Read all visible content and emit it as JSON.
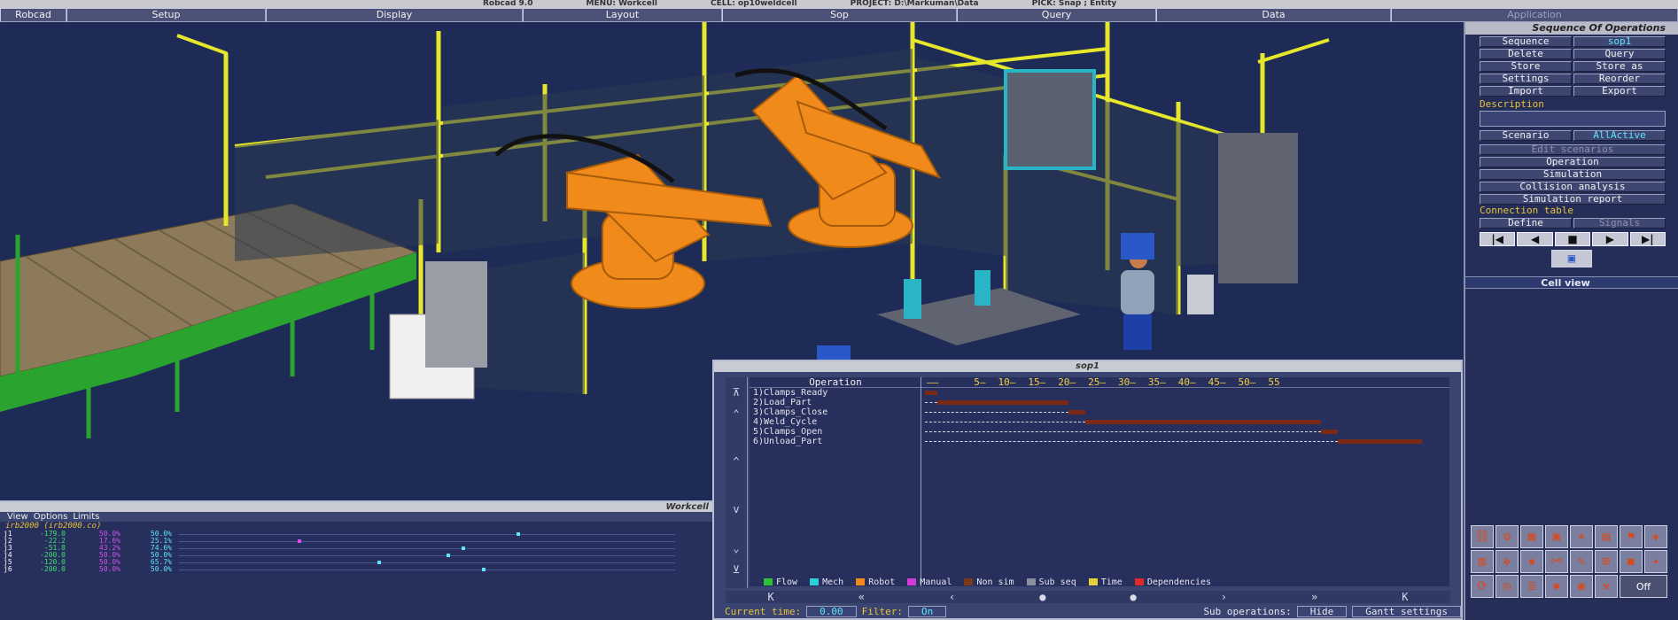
{
  "window": {
    "title_segments": [
      "Robcad 9.0",
      "MENU: Workcell",
      "CELL: op10weldcell",
      "PROJECT: D:\\Markuman\\Data",
      "PICK: Snap ; Entity"
    ]
  },
  "menubar": [
    "Robcad",
    "Setup",
    "Display",
    "Layout",
    "Sop",
    "Query",
    "Data",
    "Application"
  ],
  "sop_panel": {
    "title": "Sequence Of Operations",
    "sequence_label": "Sequence",
    "sequence_value": "sop1",
    "buttons": [
      "Delete",
      "Query",
      "Store",
      "Store as",
      "Settings",
      "Reorder",
      "Import",
      "Export"
    ],
    "description_label": "Description",
    "scenario_label": "Scenario",
    "scenario_value": "AllActive",
    "edit_scenarios": "Edit scenarios",
    "operation": "Operation",
    "simulation": "Simulation",
    "collision_analysis": "Collision analysis",
    "simulation_report": "Simulation report",
    "connection_table_label": "Connection table",
    "define": "Define",
    "signals": "Signals",
    "cell_view_title": "Cell view",
    "off_label": "Off"
  },
  "gantt": {
    "title": "sop1",
    "operation_header": "Operation",
    "scale_labels": [
      "5",
      "10",
      "15",
      "20",
      "25",
      "30",
      "35",
      "40",
      "45",
      "50",
      "55"
    ],
    "operations": [
      {
        "label": "1)Clamps_Ready",
        "start": 0,
        "end": 1.5
      },
      {
        "label": "2)Load_Part",
        "start": 1.5,
        "end": 17
      },
      {
        "label": "3)Clamps_Close",
        "start": 17,
        "end": 19
      },
      {
        "label": "4)Weld_Cycle",
        "start": 19,
        "end": 47
      },
      {
        "label": "5)Clamps_Open",
        "start": 47,
        "end": 49
      },
      {
        "label": "6)Unload_Part",
        "start": 49,
        "end": 59
      }
    ],
    "time_max": 62,
    "legend": [
      {
        "label": "Flow",
        "color": "#2fbf3a"
      },
      {
        "label": "Mech",
        "color": "#2ccfd6"
      },
      {
        "label": "Robot",
        "color": "#f08a1a"
      },
      {
        "label": "Manual",
        "color": "#d43ad8"
      },
      {
        "label": "Non sim",
        "color": "#7a3a1a"
      },
      {
        "label": "Sub seq",
        "color": "#8a8f9c"
      },
      {
        "label": "Time",
        "color": "#e6d23a"
      },
      {
        "label": "Dependencies",
        "color": "#e02a2a"
      }
    ],
    "bar_color": "#7a2a14",
    "nav": [
      "K",
      "«",
      "‹",
      "●",
      "●",
      "›",
      "»",
      "K"
    ],
    "status": {
      "current_time_label": "Current time:",
      "current_time_value": "0.00",
      "filter_label": "Filter:",
      "filter_value": "On",
      "sub_operations_label": "Sub operations:",
      "sub_operations_value": "Hide",
      "gantt_settings": "Gantt settings"
    }
  },
  "workcell": {
    "title": "Workcell",
    "menu": [
      "View",
      "Options",
      "Limits"
    ],
    "robot": "irb2000 (irb2000.co)",
    "joints": [
      {
        "n": "j1",
        "v": "-179.0",
        "p": "50.0%",
        "q": "50.0%",
        "marker": 0.68
      },
      {
        "n": "j2",
        "v": "-22.2",
        "p": "17.6%",
        "q": "25.1%",
        "marker": 0.24
      },
      {
        "n": "j3",
        "v": "-51.8",
        "p": "43.2%",
        "q": "74.6%",
        "marker": 0.57
      },
      {
        "n": "j4",
        "v": "-200.0",
        "p": "50.0%",
        "q": "50.0%",
        "marker": 0.54
      },
      {
        "n": "j5",
        "v": "-120.0",
        "p": "50.0%",
        "q": "65.7%",
        "marker": 0.4
      },
      {
        "n": "j6",
        "v": "-200.0",
        "p": "50.0%",
        "q": "50.0%",
        "marker": 0.61
      }
    ]
  }
}
